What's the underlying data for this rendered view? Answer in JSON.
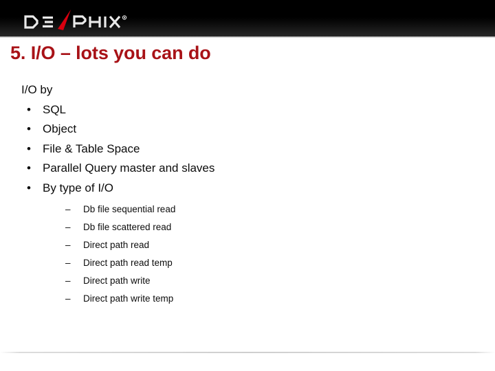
{
  "header": {
    "logo": {
      "name": "delphix-logo",
      "text_left": "DE",
      "text_right": "PHIX",
      "registered_mark": "®",
      "blade_color": "#d9000f",
      "wordmark_color": "#e9e9e9",
      "band_color": "#000000"
    }
  },
  "title": {
    "text": "5. I/O – lots you can do",
    "color": "#A81217"
  },
  "content": {
    "intro": "I/O by",
    "bullets": [
      {
        "marker": "•",
        "label": "SQL"
      },
      {
        "marker": "•",
        "label": "Object"
      },
      {
        "marker": "•",
        "label": "File  & Table Space"
      },
      {
        "marker": "•",
        "label": "Parallel Query master and slaves"
      },
      {
        "marker": "•",
        "label": "By type of I/O",
        "sub_marker": "–",
        "sub_bullets": [
          "Db file sequential read",
          "Db file scattered read",
          "Direct path read",
          "Direct path read temp",
          "Direct path write",
          "Direct path write temp"
        ]
      }
    ]
  }
}
